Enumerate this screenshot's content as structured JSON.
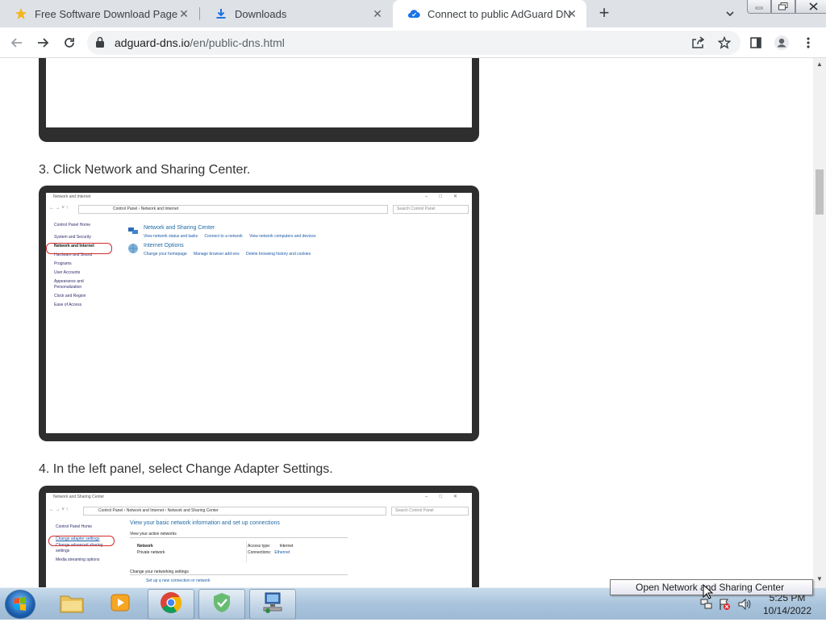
{
  "browser": {
    "tabs": [
      {
        "title": "Free Software Download Page - S",
        "icon": "star-icon",
        "active": false
      },
      {
        "title": "Downloads",
        "icon": "download-icon",
        "active": false
      },
      {
        "title": "Connect to public AdGuard DNS",
        "icon": "cloud-shield-icon",
        "active": true
      }
    ],
    "new_tab_label": "+",
    "url_domain": "adguard-dns.io",
    "url_path": "/en/public-dns.html"
  },
  "page": {
    "step3": "3. Click Network and Sharing Center.",
    "step4": "4. In the left panel, select Change Adapter Settings.",
    "shot3": {
      "window_title": "Network and Internet",
      "address": "Control Panel   ›   Network and Internet",
      "search_placeholder": "Search Control Panel",
      "sidebar": [
        "Control Panel Home",
        "System and Security",
        "Network and Internet",
        "Hardware and Sound",
        "Programs",
        "User Accounts",
        "Appearance and Personalization",
        "Clock and Region",
        "Ease of Access"
      ],
      "section1_title": "Network and Sharing Center",
      "section1_links": [
        "View network status and tasks",
        "Connect to a network",
        "View network computers and devices"
      ],
      "section2_title": "Internet Options",
      "section2_links": [
        "Change your homepage",
        "Manage browser add-ons",
        "Delete browsing history and cookies"
      ]
    },
    "shot4": {
      "window_title": "Network and Sharing Center",
      "address": "Control Panel   ›   Network and Internet   ›   Network and Sharing Center",
      "search_placeholder": "Search Control Panel",
      "sidebar": [
        "Control Panel Home",
        "Change adapter settings",
        "Change advanced sharing settings",
        "Media streaming options"
      ],
      "heading": "View your basic network information and set up connections",
      "active_networks": "View your active networks",
      "network_name": "Network",
      "network_type": "Private network",
      "access_type_label": "Access type:",
      "access_type_value": "Internet",
      "connections_label": "Connections:",
      "connections_value": "Ethernet",
      "change_settings": "Change your networking settings",
      "setup_link": "Set up a new connection or network"
    }
  },
  "taskbar": {
    "tooltip": "Open Network and Sharing Center",
    "time": "5:25 PM",
    "date": "10/14/2022"
  }
}
